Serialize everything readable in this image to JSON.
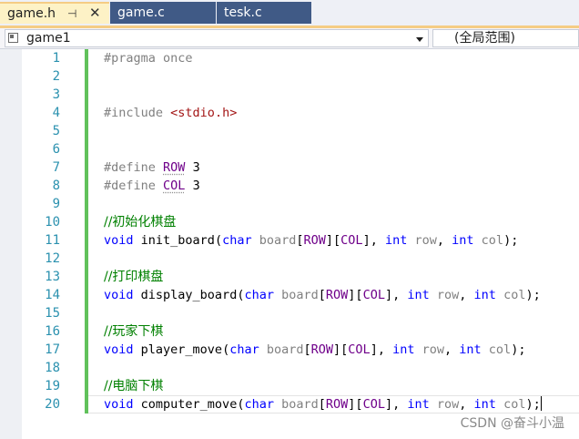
{
  "tabs": [
    {
      "label": "game.h",
      "active": true,
      "pinned": true
    },
    {
      "label": "game.c",
      "active": false
    },
    {
      "label": "tesk.c",
      "active": false
    }
  ],
  "tab_icons": {
    "pin": "pin-icon",
    "close": "close-icon"
  },
  "nav": {
    "project": "game1",
    "project_icon": "project-icon",
    "dropdown_icon": "chevron-down-icon",
    "scope": "(全局范围)"
  },
  "line_numbers": [
    "1",
    "2",
    "3",
    "4",
    "5",
    "6",
    "7",
    "8",
    "9",
    "10",
    "11",
    "12",
    "13",
    "14",
    "15",
    "16",
    "17",
    "18",
    "19",
    "20"
  ],
  "code": {
    "l1": "#pragma once",
    "l4": {
      "directive": "#include",
      "header": "<stdio.h>"
    },
    "l7": {
      "directive": "#define",
      "name": "ROW",
      "value": "3"
    },
    "l8": {
      "directive": "#define",
      "name": "COL",
      "value": "3"
    },
    "l10": "//初始化棋盘",
    "l11": "init_board",
    "l13": "//打印棋盘",
    "l14": "display_board",
    "l16": "//玩家下棋",
    "l17": "player_move",
    "l19": "//电脑下棋",
    "l20": "computer_move",
    "keywords": {
      "void": "void",
      "char": "char",
      "int": "int"
    },
    "params": {
      "board": "board",
      "row": "row",
      "col": "col"
    },
    "macros": {
      "row": "ROW",
      "col": "COL"
    }
  },
  "colors": {
    "keyword": "#0000ff",
    "macro": "#6f008a",
    "comment": "#008000",
    "preprocessor": "#808080",
    "string": "#a31515",
    "line_number": "#2b91af",
    "change_bar": "#61c15b",
    "active_tab": "#fdf2c6",
    "inactive_tab": "#405a86"
  },
  "watermark": "CSDN @奋斗小温"
}
